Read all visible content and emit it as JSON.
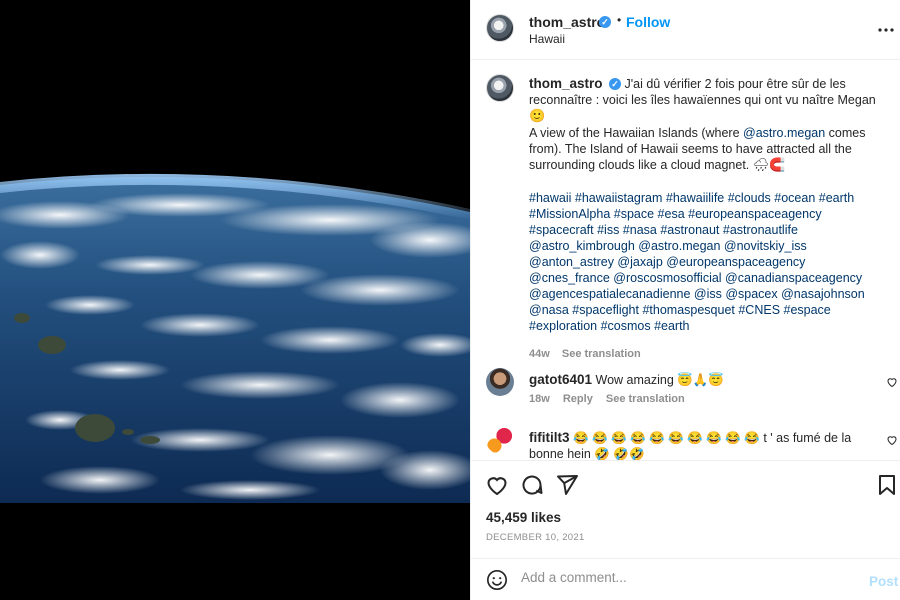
{
  "post": {
    "username": "thom_astro",
    "follow_label": "Follow",
    "dot": "•",
    "location": "Hawaii",
    "verified_mark": "✓"
  },
  "caption": {
    "username": "thom_astro",
    "fr_text": "J'ai dû vérifier 2 fois pour être sûr de les reconnaître : voici les îles hawaïennes qui ont vu naître Megan",
    "fr_emoji": "🙂",
    "en_text_1": "A view of the Hawaiian Islands (where ",
    "en_mention": "@astro.megan",
    "en_text_2": " comes from). The Island of Hawaii seems to have attracted all the surrounding clouds like a cloud magnet.",
    "en_emoji": "🌧🧲",
    "tags": "#hawaii #hawaiistagram #hawaiilife #clouds #ocean #earth #MissionAlpha #space #esa #europeanspaceagency #spacecraft #iss #nasa #astronaut #astronautlife @astro_kimbrough @astro.megan @novitskiy_iss @anton_astrey @jaxajp @europeanspaceagency @cnes_france @roscosmosofficial @canadianspaceagency @agencespatialecanadienne @iss @spacex @nasajohnson @nasa #spaceflight #thomaspesquet #CNES #espace #exploration #cosmos #earth",
    "time": "44w",
    "see_translation": "See translation"
  },
  "comments": [
    {
      "username": "gatot6401",
      "text": "Wow amazing 😇🙏😇",
      "time": "18w",
      "reply": "Reply",
      "see_translation": "See translation"
    },
    {
      "username": "fifitilt3",
      "text": "😂 😂 😂 😂 😂 😂 😂 😂 😂 😂 t ' as fumé de la bonne hein 🤣 🤣🤣"
    }
  ],
  "actions": {
    "likes": "45,459 likes",
    "date": "DECEMBER 10, 2021"
  },
  "add_comment": {
    "placeholder": "Add a comment...",
    "post_label": "Post"
  },
  "icons": [
    "more-icon",
    "heart-icon",
    "comment-icon",
    "share-icon",
    "bookmark-icon",
    "emoji-icon",
    "verified-icon"
  ],
  "colors": {
    "link": "#00376b",
    "follow": "#0095f6",
    "post_disabled": "#b2dffc",
    "muted": "#8e8e8e"
  }
}
